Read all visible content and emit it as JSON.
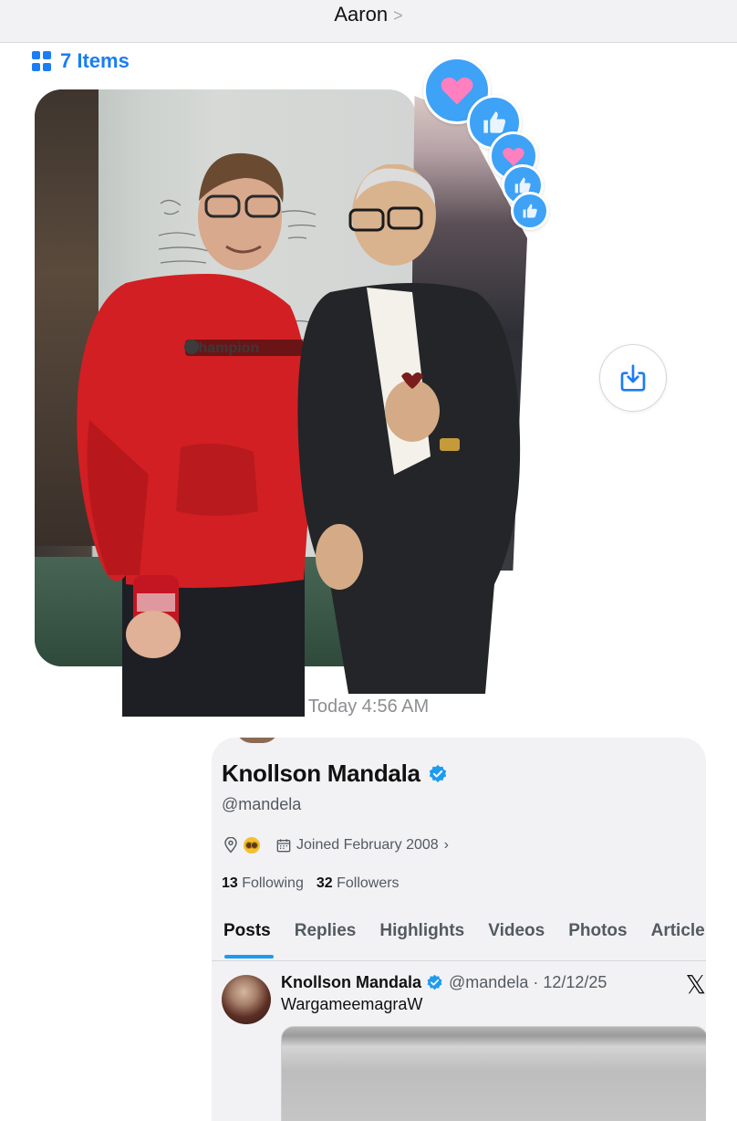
{
  "nav": {
    "title": "Aaron",
    "chevron": ">"
  },
  "items_link": {
    "label": "7 Items",
    "icon": "grid-icon"
  },
  "photo": {
    "alt": "Two people standing together in front of a whiteboard wall",
    "shirt_text": "Champion"
  },
  "reactions": [
    "heart-icon",
    "thumbs-up-icon",
    "heart-icon",
    "thumbs-up-icon",
    "thumbs-up-icon"
  ],
  "save_button": {
    "icon": "download-icon"
  },
  "timestamp": "Today 4:56 AM",
  "profile": {
    "name": "Knollson Mandala",
    "verified": true,
    "handle": "@mandela",
    "joined": "Joined February 2008",
    "following_count": "13",
    "following_label": "Following",
    "followers_count": "32",
    "followers_label": "Followers"
  },
  "tabs": [
    "Posts",
    "Replies",
    "Highlights",
    "Videos",
    "Photos",
    "Article"
  ],
  "post": {
    "name": "Knollson Mandala",
    "handle_date": "@mandela · 12/12/25",
    "text": "WargameemagraW",
    "x_logo": "𝕏"
  },
  "colors": {
    "accent": "#1a7df5",
    "tab_underline": "#1d9bf0",
    "reaction_bubble": "#3ea2f7"
  }
}
